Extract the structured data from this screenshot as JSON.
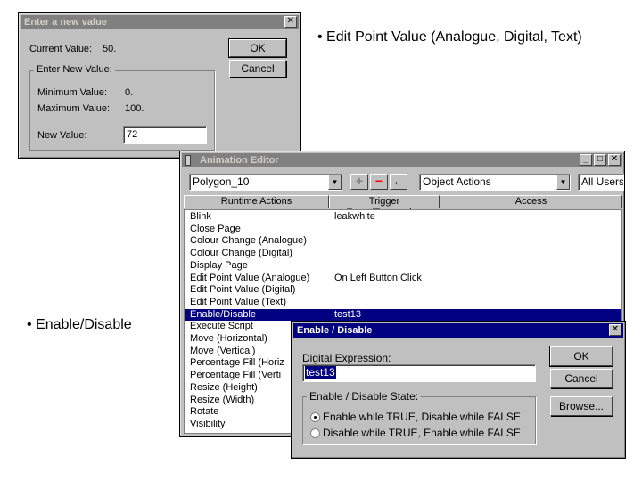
{
  "slide": {
    "bullet1": "• Edit Point Value (Analogue, Digital, Text)",
    "bullet2": "• Enable/Disable"
  },
  "enter_value_dialog": {
    "title": "Enter a new value",
    "close_glyph": "✕",
    "current_value_label": "Current Value:",
    "current_value": "50.",
    "ok_label": "OK",
    "cancel_label": "Cancel",
    "group_label": "Enter New Value:",
    "minimum_label": "Minimum Value:",
    "minimum_value": "0.",
    "maximum_label": "Maximum Value:",
    "maximum_value": "100.",
    "new_value_label": "New Value:",
    "new_value": "72"
  },
  "animation_editor": {
    "title": "Animation Editor",
    "object_combo": "Polygon_10",
    "category_combo": "Object Actions",
    "users_combo": "All Users",
    "columns": [
      "Runtime Actions",
      "Trigger Event/Expression",
      "Access"
    ],
    "rows": [
      {
        "action": "Blink",
        "trigger": "leakwhite"
      },
      {
        "action": "Close Page",
        "trigger": ""
      },
      {
        "action": "Colour Change (Analogue)",
        "trigger": ""
      },
      {
        "action": "Colour Change (Digital)",
        "trigger": ""
      },
      {
        "action": "Display Page",
        "trigger": ""
      },
      {
        "action": "Edit Point Value (Analogue)",
        "trigger": "On Left Button Click"
      },
      {
        "action": "Edit Point Value (Digital)",
        "trigger": ""
      },
      {
        "action": "Edit Point Value (Text)",
        "trigger": ""
      },
      {
        "action": "Enable/Disable",
        "trigger": "test13"
      },
      {
        "action": "Execute Script",
        "trigger": ""
      },
      {
        "action": "Move (Horizontal)",
        "trigger": ""
      },
      {
        "action": "Move (Vertical)",
        "trigger": ""
      },
      {
        "action": "Percentage Fill (Horiz",
        "trigger": ""
      },
      {
        "action": "Percentage Fill (Verti",
        "trigger": ""
      },
      {
        "action": "Resize (Height)",
        "trigger": ""
      },
      {
        "action": "Resize (Width)",
        "trigger": ""
      },
      {
        "action": "Rotate",
        "trigger": ""
      },
      {
        "action": "Visibility",
        "trigger": ""
      }
    ],
    "selected_row": 8
  },
  "enable_disable_dialog": {
    "title": "Enable / Disable",
    "close_glyph": "✕",
    "expression_label": "Digital Expression:",
    "expression_value": "test13",
    "ok_label": "OK",
    "cancel_label": "Cancel",
    "browse_label": "Browse...",
    "group_label": "Enable / Disable State:",
    "option1": "Enable while TRUE, Disable while FALSE",
    "option2": "Disable while TRUE, Enable while FALSE",
    "selected_option": 1
  },
  "icons": {
    "minimize": "_",
    "maximize": "□",
    "close": "✕",
    "add": "+",
    "remove": "−",
    "back": "←",
    "dropdown": "▼"
  },
  "colors": {
    "title_active": "#000080",
    "title_inactive": "#808080",
    "face": "#c0c0c0",
    "remove_icon": "#ff0000"
  }
}
